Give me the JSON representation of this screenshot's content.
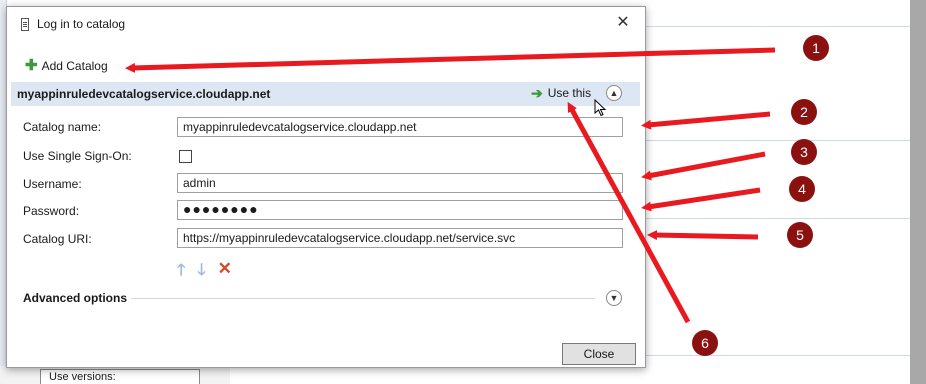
{
  "background": {
    "partial_field_label": "Use versions:"
  },
  "dialog": {
    "title": "Log in to catalog",
    "close_glyph": "✕",
    "add_catalog_label": "Add Catalog",
    "catalog_header_name": "myappinruledevcatalogservice.cloudapp.net",
    "use_this_label": "Use this",
    "fields": {
      "catalog_name": {
        "label": "Catalog name:",
        "value": "myappinruledevcatalogservice.cloudapp.net"
      },
      "single_sign_on": {
        "label": "Use Single Sign-On:",
        "checked": false
      },
      "username": {
        "label": "Username:",
        "value": "admin"
      },
      "password": {
        "label": "Password:",
        "value": "●●●●●●●●"
      },
      "catalog_uri": {
        "label": "Catalog URI:",
        "value": "https://myappinruledevcatalogservice.cloudapp.net/service.svc"
      }
    },
    "advanced_options_label": "Advanced options",
    "close_button_label": "Close"
  },
  "annotations": {
    "badges": [
      "1",
      "2",
      "3",
      "4",
      "5",
      "6"
    ],
    "arrow_color": "#e8191f",
    "badge_color": "#8b1111"
  },
  "colors": {
    "header_bg": "#dde7f3",
    "green_icon": "#3c9a3c",
    "delete_icon": "#d24a2a"
  }
}
